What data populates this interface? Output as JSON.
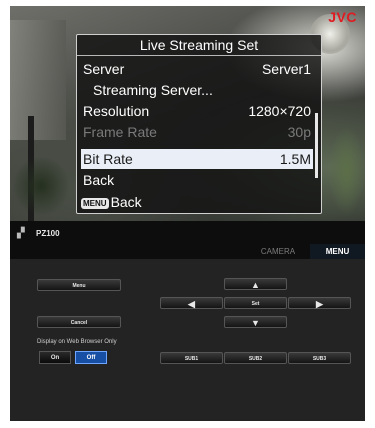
{
  "brand": "JVC",
  "osd": {
    "title": "Live Streaming Set",
    "rows": [
      {
        "label": "Server",
        "value": "Server1",
        "state": "normal"
      },
      {
        "label": "Streaming Server...",
        "value": "",
        "state": "normal"
      },
      {
        "label": "Resolution",
        "value": "1280×720",
        "state": "normal"
      },
      {
        "label": "Frame Rate",
        "value": "30p",
        "state": "disabled"
      },
      {
        "label": "Bit Rate",
        "value": "1.5M",
        "state": "selected"
      },
      {
        "label": "Back",
        "value": "",
        "state": "normal"
      }
    ],
    "menu_key": "MENU",
    "menu_back": "Back"
  },
  "status": {
    "device_name": "PZ100",
    "device_icon": "camera-icon"
  },
  "tabs": {
    "camera": "CAMERA",
    "menu": "MENU",
    "active": "menu"
  },
  "controls": {
    "menu_button": "Menu",
    "cancel_button": "Cancel",
    "up_icon": "▲",
    "down_icon": "▼",
    "left_icon": "◀",
    "right_icon": "▶",
    "set_button": "Set",
    "sub1": "SUB1",
    "sub2": "SUB2",
    "sub3": "SUB3",
    "browser_only_label": "Display on Web Browser Only",
    "on_label": "On",
    "off_label": "Off",
    "display_mode": "Off"
  },
  "colors": {
    "logo": "#e01b22",
    "active_tab_underline": "#1f6fd0",
    "toggle_active": "#174fa5",
    "selected_row": "#e9eef7"
  }
}
